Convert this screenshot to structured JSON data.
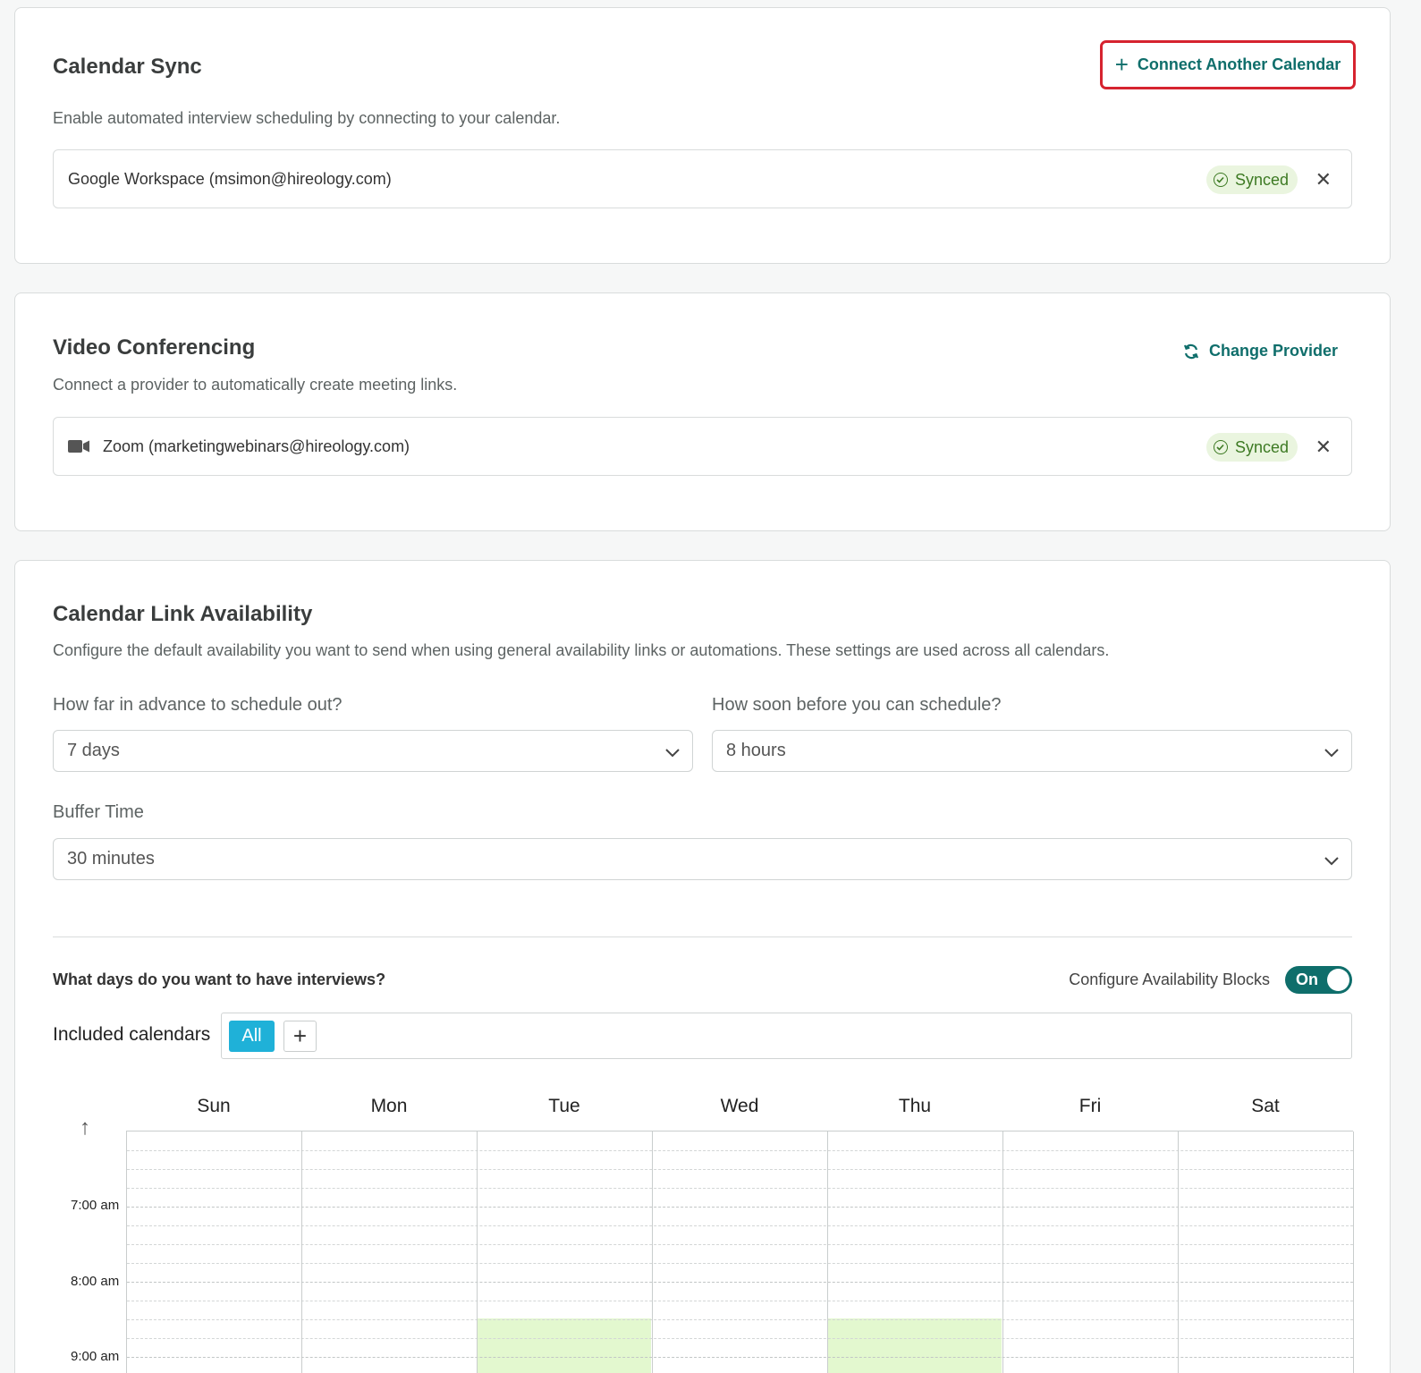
{
  "calendar_sync": {
    "title": "Calendar Sync",
    "description": "Enable automated interview scheduling by connecting to your calendar.",
    "connect_button": "Connect Another Calendar",
    "connection": {
      "label": "Google Workspace (msimon@hireology.com)",
      "status": "Synced"
    }
  },
  "video_conferencing": {
    "title": "Video Conferencing",
    "description": "Connect a provider to automatically create meeting links.",
    "change_provider": "Change Provider",
    "connection": {
      "label": "Zoom (marketingwebinars@hireology.com)",
      "status": "Synced"
    }
  },
  "availability": {
    "title": "Calendar Link Availability",
    "description": "Configure the default availability you want to send when using general availability links or automations. These settings are used across all calendars.",
    "advance": {
      "label": "How far in advance to schedule out?",
      "value": "7 days"
    },
    "notice": {
      "label": "How soon before you can schedule?",
      "value": "8 hours"
    },
    "buffer": {
      "label": "Buffer Time",
      "value": "30 minutes"
    },
    "days_question": "What days do you want to have interviews?",
    "configure_blocks": {
      "label": "Configure Availability Blocks",
      "state": "On"
    },
    "included_calendars": {
      "label": "Included calendars",
      "chip": "All"
    },
    "days": [
      "Sun",
      "Mon",
      "Tue",
      "Wed",
      "Thu",
      "Fri",
      "Sat"
    ],
    "times": [
      "7:00 am",
      "8:00 am",
      "9:00 am"
    ],
    "available_days": [
      "Tue",
      "Thu"
    ],
    "available_start": "9:00 am"
  },
  "colors": {
    "accent": "#0f6e6b",
    "highlight_border": "#d6232f",
    "synced_bg": "#eaf5df",
    "chip_all": "#1fb1d8",
    "availability_fill": "#e3f8cf"
  }
}
